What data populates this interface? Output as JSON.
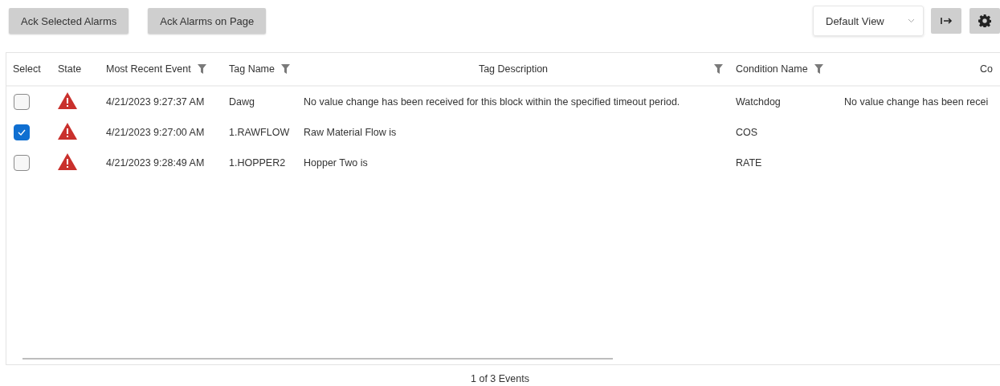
{
  "toolbar": {
    "buttons": [
      "Ack Selected Alarms",
      "Ack Alarms on Page"
    ],
    "view_select": {
      "value": "Default View"
    }
  },
  "table": {
    "columns": [
      {
        "label": "Select",
        "filter": false
      },
      {
        "label": "State",
        "filter": false
      },
      {
        "label": "Most Recent Event",
        "filter": true
      },
      {
        "label": "Tag Name",
        "filter": true
      },
      {
        "label": "Tag Description",
        "filter": true
      },
      {
        "label": "Condition Name",
        "filter": true
      },
      {
        "label": "Co",
        "filter": false
      }
    ],
    "rows": [
      {
        "selected": false,
        "cells": [
          "",
          "",
          "4/21/2023 9:27:37 AM",
          "Dawg",
          "No value change has been received for this block within the specified timeout period.",
          "Watchdog",
          "No value change has been recei"
        ]
      },
      {
        "selected": true,
        "cells": [
          "",
          "",
          "4/21/2023 9:27:00 AM",
          "1.RAWFLOW",
          "Raw Material Flow is",
          "COS",
          ""
        ]
      },
      {
        "selected": false,
        "cells": [
          "",
          "",
          "4/21/2023 9:28:49 AM",
          "1.HOPPER2",
          "Hopper Two is",
          "RATE",
          ""
        ]
      }
    ]
  },
  "footer": "1 of 3 Events"
}
